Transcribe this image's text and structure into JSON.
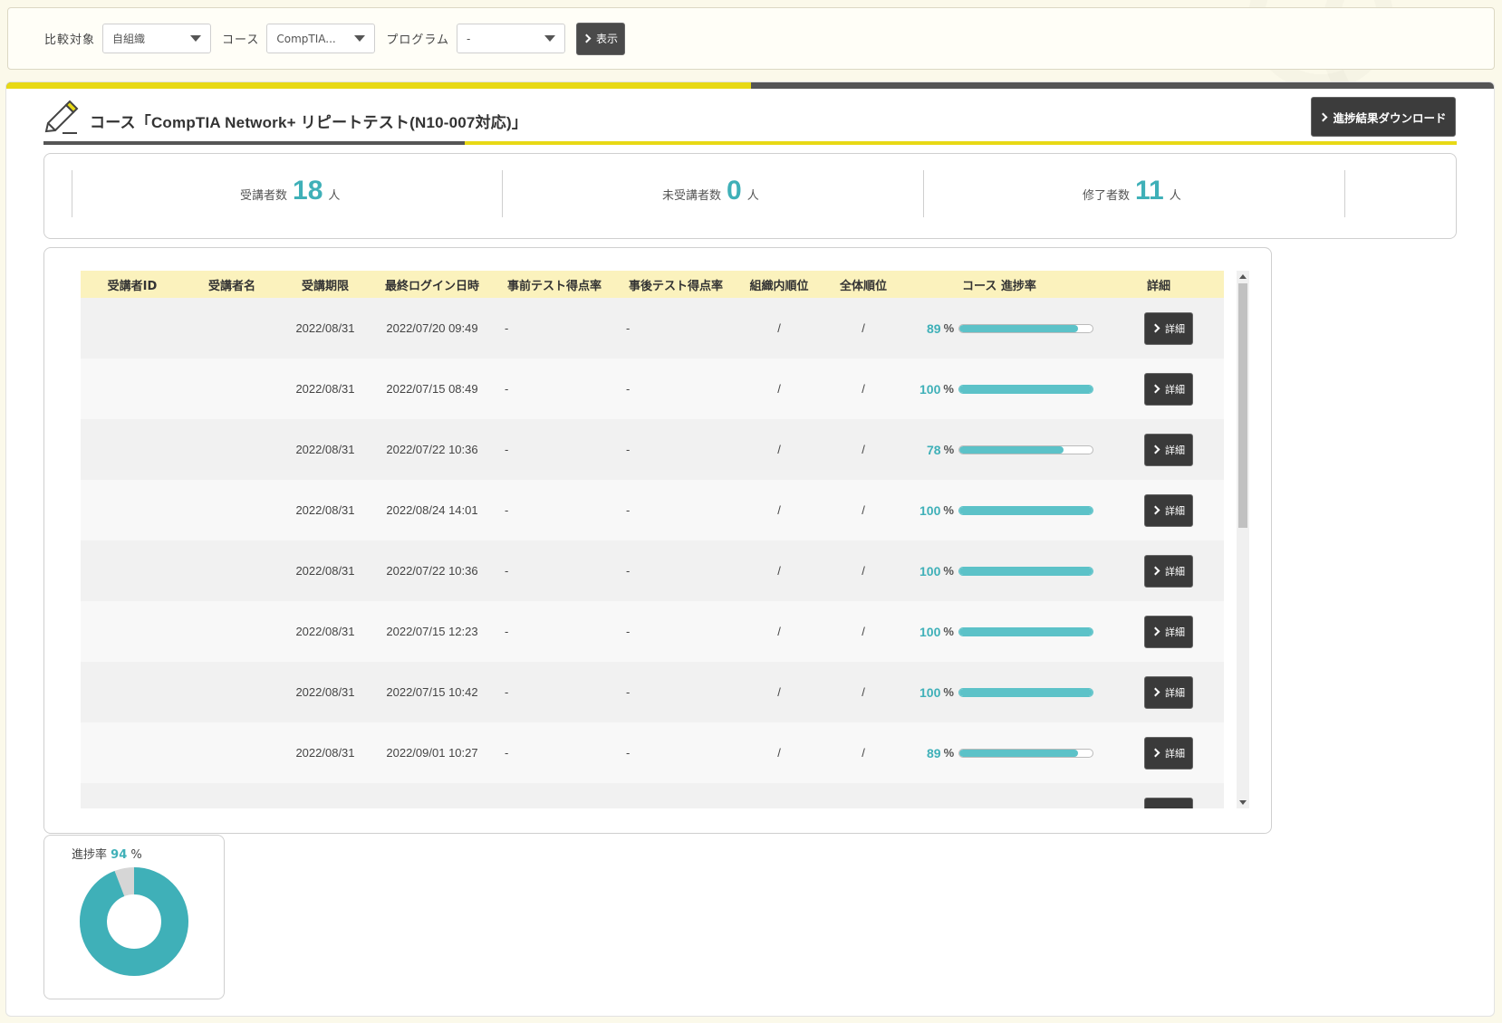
{
  "filter": {
    "compare_label": "比較対象",
    "compare_value": "自組織",
    "course_label": "コース",
    "course_value": "CompTIA...",
    "program_label": "プログラム",
    "program_value": "-",
    "show_button": "表示"
  },
  "course": {
    "title": "コース「CompTIA Network+ リピートテスト(N10-007対応)」",
    "download_button": "進捗結果ダウンロード"
  },
  "stats": [
    {
      "label": "受講者数",
      "value": "18",
      "unit": "人"
    },
    {
      "label": "未受講者数",
      "value": "0",
      "unit": "人"
    },
    {
      "label": "修了者数",
      "value": "11",
      "unit": "人"
    }
  ],
  "table": {
    "headers": [
      "受講者ID",
      "受講者名",
      "受講期限",
      "最終ログイン日時",
      "事前テスト得点率",
      "事後テスト得点率",
      "組織内順位",
      "全体順位",
      "コース 進捗率",
      "詳細"
    ],
    "pct_sign": "%",
    "detail_label": "詳細",
    "rows": [
      {
        "id": "",
        "name": "",
        "deadline": "2022/08/31",
        "last_login": "2022/07/20 09:49",
        "pre": "-",
        "post": "-",
        "org_rank": "/",
        "all_rank": "/",
        "progress": "89",
        "progress_fraction": 0.89
      },
      {
        "id": "",
        "name": "",
        "deadline": "2022/08/31",
        "last_login": "2022/07/15 08:49",
        "pre": "-",
        "post": "-",
        "org_rank": "/",
        "all_rank": "/",
        "progress": "100",
        "progress_fraction": 1.0
      },
      {
        "id": "",
        "name": "",
        "deadline": "2022/08/31",
        "last_login": "2022/07/22 10:36",
        "pre": "-",
        "post": "-",
        "org_rank": "/",
        "all_rank": "/",
        "progress": "78",
        "progress_fraction": 0.78
      },
      {
        "id": "",
        "name": "",
        "deadline": "2022/08/31",
        "last_login": "2022/08/24 14:01",
        "pre": "-",
        "post": "-",
        "org_rank": "/",
        "all_rank": "/",
        "progress": "100",
        "progress_fraction": 1.0
      },
      {
        "id": "",
        "name": "",
        "deadline": "2022/08/31",
        "last_login": "2022/07/22 10:36",
        "pre": "-",
        "post": "-",
        "org_rank": "/",
        "all_rank": "/",
        "progress": "100",
        "progress_fraction": 1.0
      },
      {
        "id": "",
        "name": "",
        "deadline": "2022/08/31",
        "last_login": "2022/07/15 12:23",
        "pre": "-",
        "post": "-",
        "org_rank": "/",
        "all_rank": "/",
        "progress": "100",
        "progress_fraction": 1.0
      },
      {
        "id": "",
        "name": "",
        "deadline": "2022/08/31",
        "last_login": "2022/07/15 10:42",
        "pre": "-",
        "post": "-",
        "org_rank": "/",
        "all_rank": "/",
        "progress": "100",
        "progress_fraction": 1.0
      },
      {
        "id": "",
        "name": "",
        "deadline": "2022/08/31",
        "last_login": "2022/09/01 10:27",
        "pre": "-",
        "post": "-",
        "org_rank": "/",
        "all_rank": "/",
        "progress": "89",
        "progress_fraction": 0.89
      },
      {
        "id": "",
        "name": "",
        "deadline": "",
        "last_login": "",
        "pre": "",
        "post": "",
        "org_rank": "",
        "all_rank": "",
        "progress": "",
        "progress_fraction": 0
      }
    ]
  },
  "donut": {
    "label": "進捗率",
    "value": "94",
    "unit": "%",
    "fraction": 0.94,
    "fill_color": "#3fb0b8",
    "rest_color": "#d6d6d6"
  },
  "colors": {
    "accent": "#3fb0b8",
    "yellow": "#e8d915",
    "dark": "#3c3c3c"
  }
}
